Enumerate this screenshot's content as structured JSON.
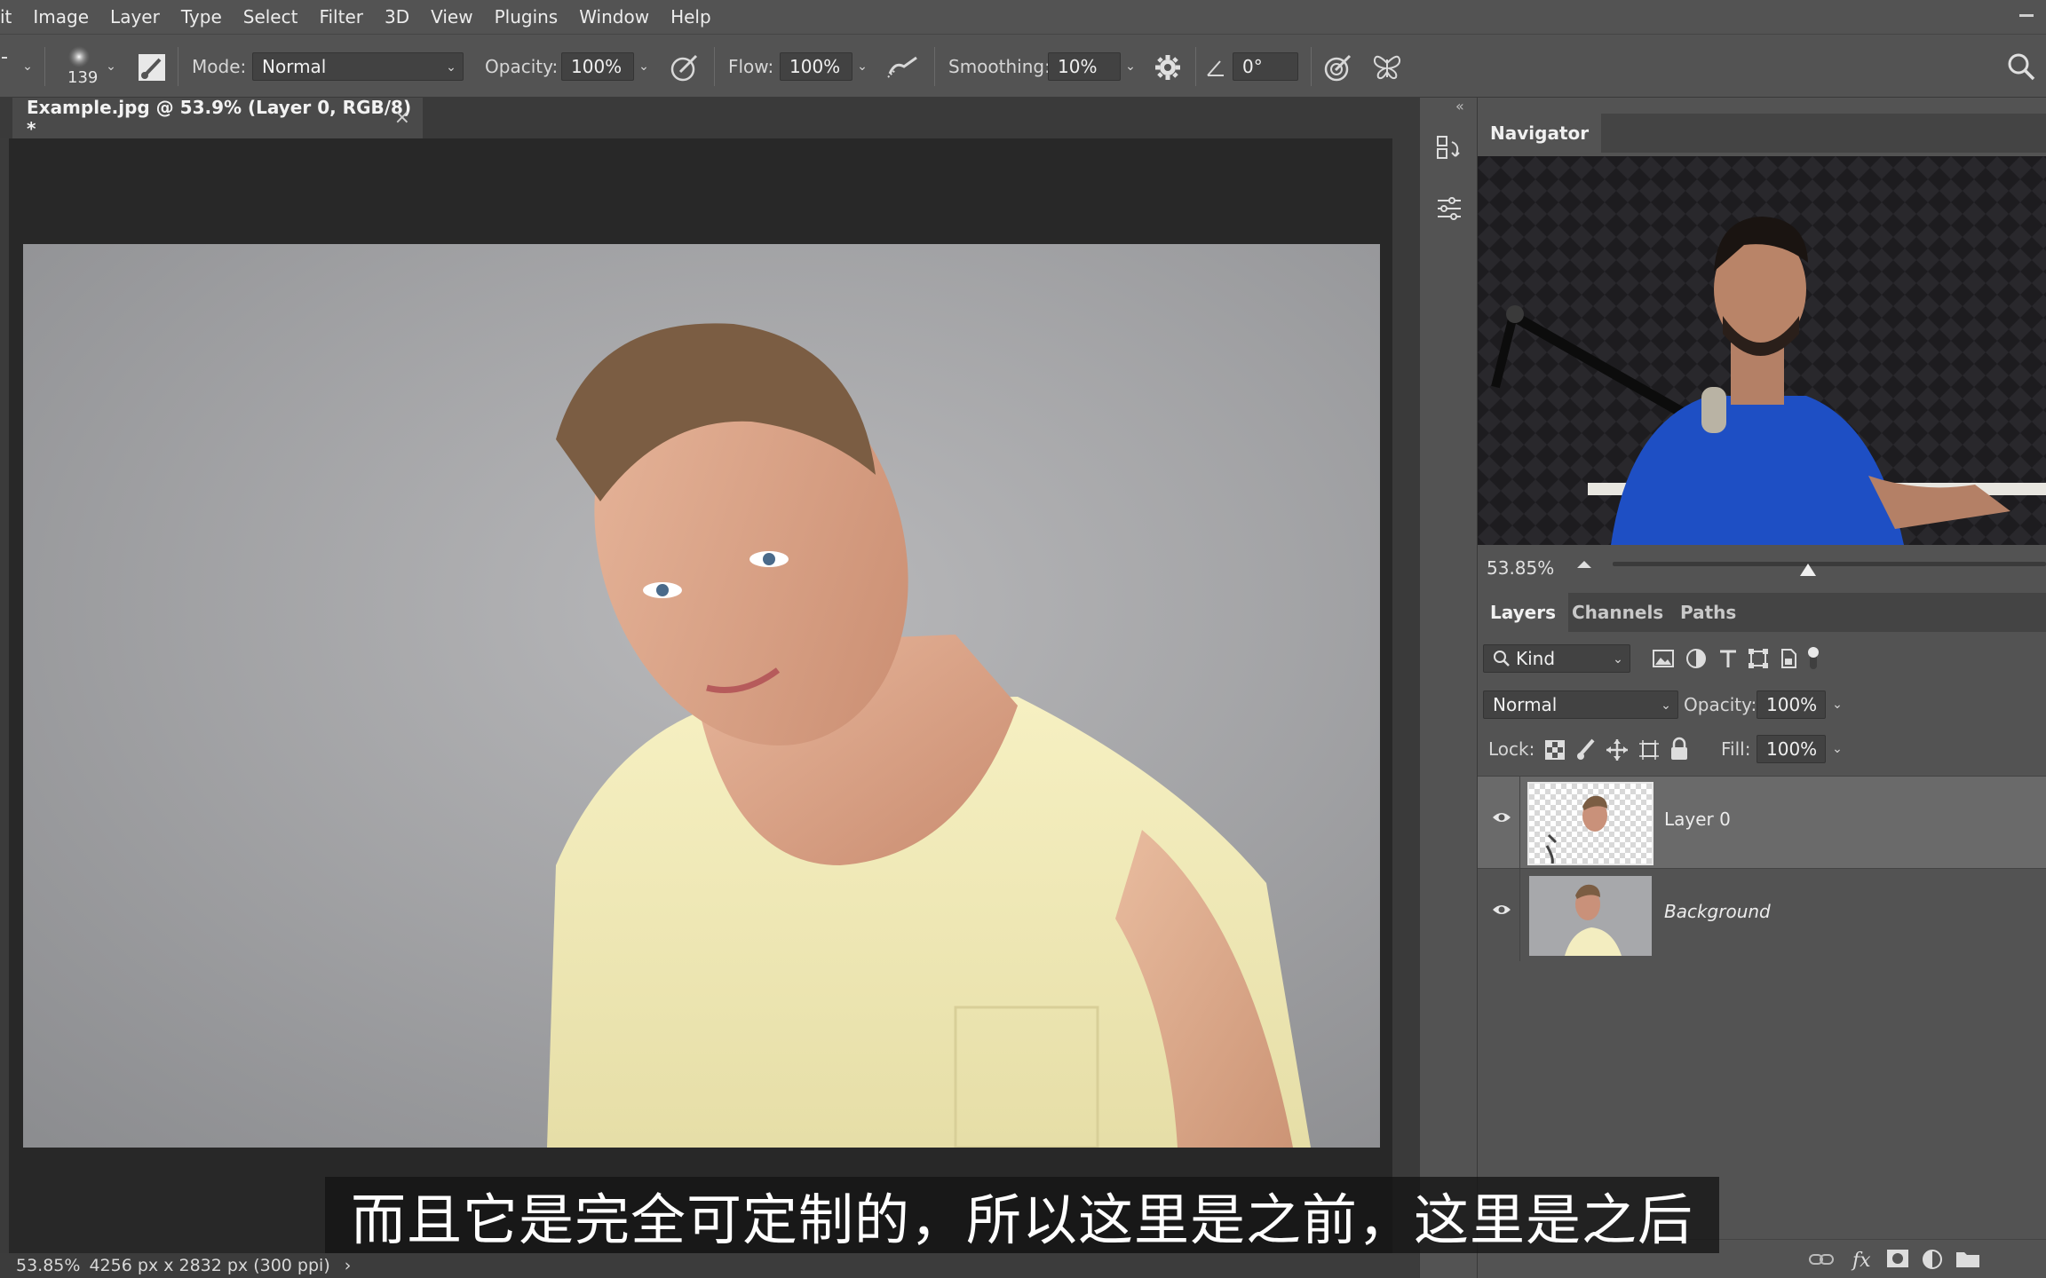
{
  "menu": [
    "it",
    "Image",
    "Layer",
    "Type",
    "Select",
    "Filter",
    "3D",
    "View",
    "Plugins",
    "Window",
    "Help"
  ],
  "options": {
    "brush_size": "139",
    "mode_label": "Mode:",
    "mode_value": "Normal",
    "opacity_label": "Opacity:",
    "opacity_value": "100%",
    "flow_label": "Flow:",
    "flow_value": "100%",
    "smoothing_label": "Smoothing:",
    "smoothing_value": "10%",
    "angle_value": "0°"
  },
  "document": {
    "tab_title": "Example.jpg @ 53.9% (Layer 0, RGB/8) *",
    "close_glyph": "×"
  },
  "navigator": {
    "tab": "Navigator",
    "zoom": "53.85%",
    "slider_level": 0.45,
    "collapse_glyph": "«"
  },
  "layers_panel": {
    "tabs": [
      "Layers",
      "Channels",
      "Paths"
    ],
    "filter_kind": "Kind",
    "blend_mode": "Normal",
    "opacity_label": "Opacity:",
    "opacity_value": "100%",
    "lock_label": "Lock:",
    "fill_label": "Fill:",
    "fill_value": "100%",
    "layers": [
      {
        "name": "Layer 0",
        "selected": true,
        "visible": true
      },
      {
        "name": "Background",
        "selected": false,
        "visible": true
      }
    ]
  },
  "status": {
    "zoom": "53.85%",
    "dimensions": "4256 px x 2832 px (300 ppi)",
    "arrow": "›"
  },
  "subtitle": "而且它是完全可定制的，所以这里是之前，这里是之后",
  "colors": {
    "panel_bg": "#535353",
    "canvas_bg": "#282828",
    "selected_layer": "#6a6a6a"
  }
}
